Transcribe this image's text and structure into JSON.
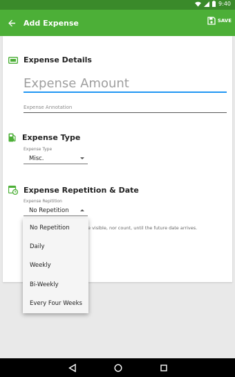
{
  "status": {
    "time": "9:40"
  },
  "app_bar": {
    "title": "Add Expense",
    "save_label": "SAVE"
  },
  "details": {
    "title": "Expense Details",
    "amount_placeholder": "Expense Amount",
    "annotation_placeholder": "Expense Annotation"
  },
  "type": {
    "title": "Expense Type",
    "field_label": "Expense Type",
    "selected": "Misc."
  },
  "repetition": {
    "title": "Expense Repetition & Date",
    "field_label": "Expense Repitition",
    "selected": "No Repetition",
    "hint": "e visible, nor count, until the future date arrives.",
    "options": [
      "No Repetition",
      "Daily",
      "Weekly",
      "Bi-Weekly",
      "Every Four Weeks"
    ]
  },
  "colors": {
    "primary": "#4caf37",
    "status_bar": "#3a8a2a",
    "accent": "#2196f3"
  }
}
